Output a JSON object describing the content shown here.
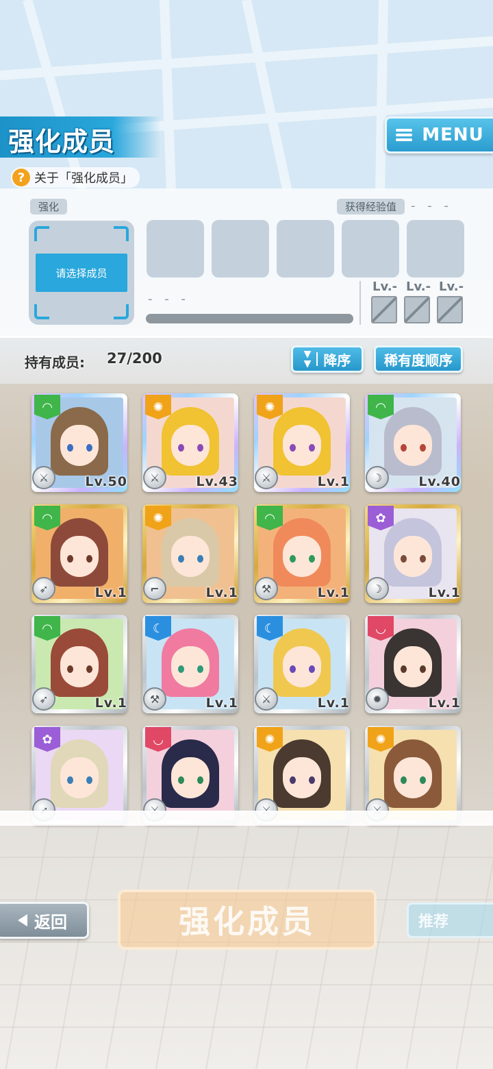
{
  "header": {
    "title": "强化成员",
    "menu_label": "MENU",
    "about_label": "关于「强化成员」"
  },
  "panel": {
    "enhance_tag": "强化",
    "exp_tag": "获得经验值",
    "exp_value": "- - -",
    "select_member_label": "请选择成员",
    "progress_text": "- - -",
    "material_levels": [
      "Lv.-",
      "Lv.-",
      "Lv.-"
    ]
  },
  "members": {
    "count_label": "持有成员:",
    "count_value": "27/200",
    "sort_order_label": "降序",
    "sort_key_label": "稀有度顺序",
    "cards": [
      {
        "frame": "rainbow",
        "attribute": "green",
        "weapon": "sword-icon",
        "level": "Lv.50",
        "hair": "#8a6a4a",
        "eyes": "#3a6fc2",
        "bg": "#a8c8e8"
      },
      {
        "frame": "rainbow",
        "attribute": "orange",
        "weapon": "sword-icon",
        "level": "Lv.43",
        "hair": "#f1c232",
        "eyes": "#8a4ab8",
        "bg": "#f4d8d0"
      },
      {
        "frame": "rainbow",
        "attribute": "orange",
        "weapon": "sword-icon",
        "level": "Lv.1",
        "hair": "#f1c232",
        "eyes": "#8a4ab8",
        "bg": "#f4d8d0"
      },
      {
        "frame": "rainbow",
        "attribute": "green",
        "weapon": "scythe-icon",
        "level": "Lv.40",
        "hair": "#b9bccd",
        "eyes": "#b5453a",
        "bg": "#d6e4f0"
      },
      {
        "frame": "gold",
        "attribute": "green",
        "weapon": "spear-icon",
        "level": "Lv.1",
        "hair": "#8d4a3a",
        "eyes": "#6d3a2a",
        "bg": "#f1b06a"
      },
      {
        "frame": "gold",
        "attribute": "orange",
        "weapon": "gun-icon",
        "level": "Lv.1",
        "hair": "#d9c9a8",
        "eyes": "#3a7fb5",
        "bg": "#f0c090"
      },
      {
        "frame": "gold",
        "attribute": "green",
        "weapon": "hammer-icon",
        "level": "Lv.1",
        "hair": "#f08a5a",
        "eyes": "#2e9a5a",
        "bg": "#f3b27a"
      },
      {
        "frame": "gold",
        "attribute": "purple",
        "weapon": "scythe-icon",
        "level": "Lv.1",
        "hair": "#c4c4dc",
        "eyes": "#7a4a3a",
        "bg": "#e8e4f0"
      },
      {
        "frame": "silver",
        "attribute": "green",
        "weapon": "spear-icon",
        "level": "Lv.1",
        "hair": "#9a4a38",
        "eyes": "#6d3a2a",
        "bg": "#c9e9b0"
      },
      {
        "frame": "silver",
        "attribute": "blue",
        "weapon": "hammer-icon",
        "level": "Lv.1",
        "hair": "#f07aa0",
        "eyes": "#2e9a7a",
        "bg": "#c8e4f4"
      },
      {
        "frame": "silver",
        "attribute": "blue",
        "weapon": "sword-icon",
        "level": "Lv.1",
        "hair": "#f0c850",
        "eyes": "#6a4ab8",
        "bg": "#c8e4f4"
      },
      {
        "frame": "silver",
        "attribute": "red",
        "weapon": "shield-icon",
        "level": "Lv.1",
        "hair": "#3a3432",
        "eyes": "#5a3a2a",
        "bg": "#f4d0dc"
      },
      {
        "frame": "silver",
        "attribute": "purple",
        "weapon": "spear-icon",
        "level": "",
        "hair": "#e0d8b8",
        "eyes": "#3a7fb5",
        "bg": "#ead8f4"
      },
      {
        "frame": "silver",
        "attribute": "red",
        "weapon": "sword-icon",
        "level": "",
        "hair": "#2a2a4a",
        "eyes": "#2e8a5a",
        "bg": "#f4d0dc"
      },
      {
        "frame": "silver",
        "attribute": "orange",
        "weapon": "sword-icon",
        "level": "",
        "hair": "#4a3a30",
        "eyes": "#4a3a6a",
        "bg": "#f6e0b0"
      },
      {
        "frame": "silver",
        "attribute": "orange",
        "weapon": "sword-icon",
        "level": "",
        "hair": "#8a5a3a",
        "eyes": "#2e8a5a",
        "bg": "#f6e0b0"
      }
    ]
  },
  "footer": {
    "back_label": "返回",
    "enhance_button_label": "强化成员",
    "recommend_label": "推荐"
  }
}
